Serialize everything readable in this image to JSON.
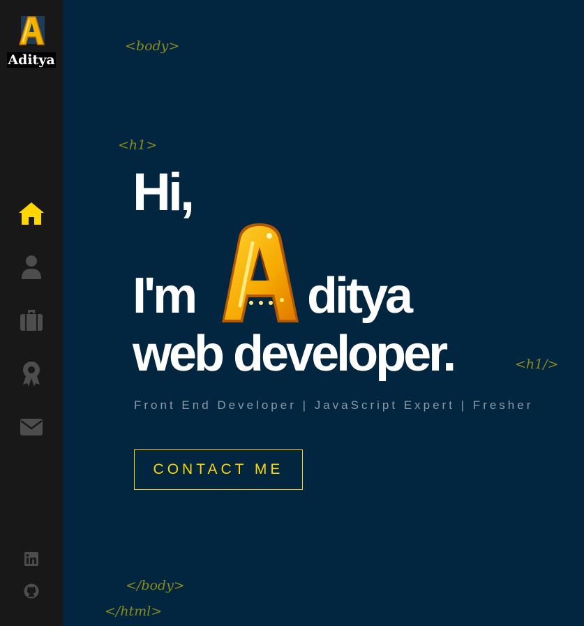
{
  "brand": {
    "logo_letter": "A",
    "name": "Aditya"
  },
  "nav": [
    {
      "name": "home-icon",
      "active": true
    },
    {
      "name": "user-icon",
      "active": false
    },
    {
      "name": "briefcase-icon",
      "active": false
    },
    {
      "name": "award-icon",
      "active": false
    },
    {
      "name": "envelope-icon",
      "active": false
    }
  ],
  "social": [
    {
      "name": "linkedin-icon"
    },
    {
      "name": "github-icon"
    }
  ],
  "tags": {
    "body_open": "<body>",
    "h1_open": "<h1>",
    "h1_close": "<h1/>",
    "body_close": "</body>",
    "html_close": "</html>"
  },
  "hero": {
    "greeting": "Hi,",
    "im": "I'm",
    "name_letter": "A",
    "name_rest": "ditya",
    "role": "web developer."
  },
  "subtitle": "Front End Developer | JavaScript Expert | Fresher",
  "cta": {
    "label": "CONTACT ME"
  },
  "colors": {
    "background": "#022640",
    "sidebar": "#181818",
    "accent": "#ffd700",
    "tag": "#8a8a1e",
    "icon_inactive": "#4d4d4e"
  }
}
